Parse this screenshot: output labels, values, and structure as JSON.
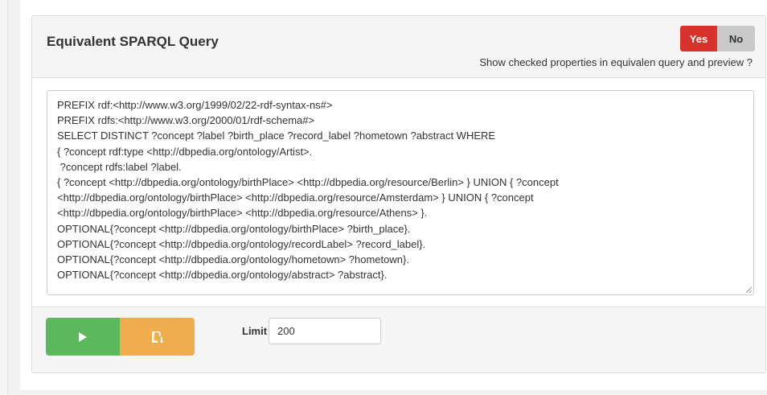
{
  "panel": {
    "title": "Equivalent SPARQL Query",
    "toggle": {
      "yes_label": "Yes",
      "no_label": "No",
      "selected": "Yes",
      "caption": "Show checked properties in equivalen query and preview ?"
    }
  },
  "query": {
    "lines": [
      "PREFIX rdf:<http://www.w3.org/1999/02/22-rdf-syntax-ns#>",
      "PREFIX rdfs:<http://www.w3.org/2000/01/rdf-schema#>",
      "SELECT DISTINCT ?concept ?label ?birth_place ?record_label ?hometown ?abstract WHERE",
      "{ ?concept rdf:type <http://dbpedia.org/ontology/Artist>.",
      " ?concept rdfs:label ?label.",
      "{ ?concept <http://dbpedia.org/ontology/birthPlace> <http://dbpedia.org/resource/Berlin> } UNION { ?concept",
      "<http://dbpedia.org/ontology/birthPlace> <http://dbpedia.org/resource/Amsterdam> } UNION { ?concept",
      "<http://dbpedia.org/ontology/birthPlace> <http://dbpedia.org/resource/Athens> }.",
      "OPTIONAL{?concept <http://dbpedia.org/ontology/birthPlace> ?birth_place}.",
      "OPTIONAL{?concept <http://dbpedia.org/ontology/recordLabel> ?record_label}.",
      "OPTIONAL{?concept <http://dbpedia.org/ontology/hometown> ?hometown}.",
      "OPTIONAL{?concept <http://dbpedia.org/ontology/abstract> ?abstract}."
    ]
  },
  "footer": {
    "run_icon": "play-icon",
    "save_icon": "save-icon",
    "limit_label": "Limit",
    "limit_value": "200"
  },
  "colors": {
    "yes_active": "#d9312b",
    "no_inactive": "#c9c9c9",
    "run_button": "#5cb85c",
    "save_button": "#f0ad4e"
  }
}
